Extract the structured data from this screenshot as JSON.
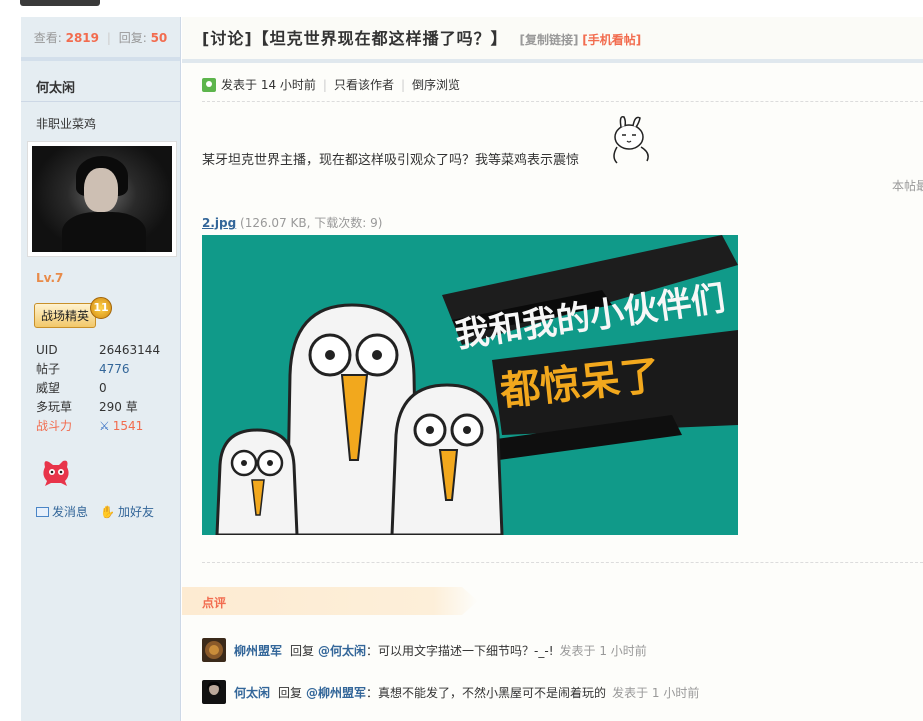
{
  "sidebar": {
    "views_label": "查看:",
    "views_value": "2819",
    "replies_label": "回复:",
    "replies_value": "50",
    "username": "何太闲",
    "user_title": "非职业菜鸡",
    "level": "Lv.7",
    "medal_label": "战场精英",
    "medal_number": "11",
    "info": [
      {
        "key": "UID",
        "value": "26463144"
      },
      {
        "key": "帖子",
        "value": "4776"
      },
      {
        "key": "威望",
        "value": "0"
      },
      {
        "key": "多玩草",
        "value": "290 草"
      },
      {
        "key": "战斗力",
        "value": "1541"
      }
    ],
    "send_message": "发消息",
    "add_friend": "加好友"
  },
  "post": {
    "title": "[讨论]【坦克世界现在都这样播了吗？】",
    "copy_link": "[复制链接]",
    "mobile_view": "[手机看帖]",
    "posted_at": "发表于 14 小时前",
    "only_author": "只看该作者",
    "reverse_order": "倒序浏览",
    "body": "某牙坦克世界主播，现在都这样吸引观众了吗？我等菜鸡表示震惊",
    "truncated_note": "本帖最",
    "attachment_name": "2.jpg",
    "attachment_meta": "(126.07 KB, 下载次数: 9)",
    "image_text_line1": "我和我的小伙伴们",
    "image_text_line2": "都惊呆了"
  },
  "reviews": {
    "header": "点评",
    "items": [
      {
        "author": "柳州盟军",
        "reply_word": "回复",
        "mention": "@何太闲",
        "text": "：可以用文字描述一下细节吗？-_-!",
        "time": "发表于 1 小时前"
      },
      {
        "author": "何太闲",
        "reply_word": "回复",
        "mention": "@柳州盟军",
        "text": "：真想不能发了，不然小黑屋可不是闹着玩的",
        "time": "发表于 1 小时前"
      }
    ]
  },
  "colors": {
    "accent_orange": "#f26c4f",
    "link_blue": "#336699",
    "sidebar_bg": "#e5edf2",
    "image_teal": "#109a89"
  }
}
